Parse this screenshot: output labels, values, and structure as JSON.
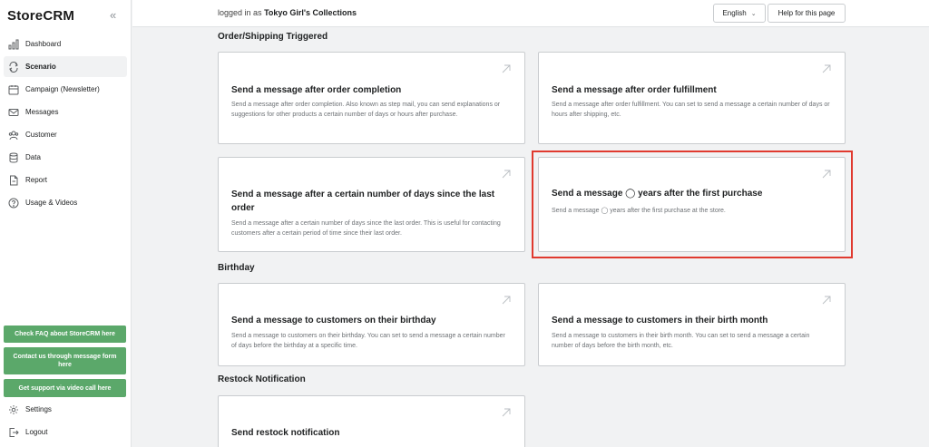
{
  "sidebar": {
    "brand": "StoreCRM",
    "collapse_glyph": "«",
    "items": [
      {
        "label": "Dashboard",
        "icon": "bar-chart-icon",
        "active": false
      },
      {
        "label": "Scenario",
        "icon": "refresh-icon",
        "active": true
      },
      {
        "label": "Campaign (Newsletter)",
        "icon": "calendar-icon",
        "active": false
      },
      {
        "label": "Messages",
        "icon": "envelope-icon",
        "active": false
      },
      {
        "label": "Customer",
        "icon": "users-icon",
        "active": false
      },
      {
        "label": "Data",
        "icon": "database-icon",
        "active": false
      },
      {
        "label": "Report",
        "icon": "document-icon",
        "active": false
      },
      {
        "label": "Usage & Videos",
        "icon": "help-circle-icon",
        "active": false
      }
    ],
    "buttons": {
      "faq": "Check FAQ about StoreCRM here",
      "contact": "Contact us through message form here",
      "video": "Get support via video call here"
    },
    "bottom_items": [
      {
        "label": "Settings",
        "icon": "gear-icon"
      },
      {
        "label": "Logout",
        "icon": "logout-icon"
      }
    ],
    "accent_color": "#5ba86a"
  },
  "topbar": {
    "logged_prefix": "logged in as",
    "store_name": "Tokyo Girl's Collections",
    "language": "English",
    "help_label": "Help for this page"
  },
  "sections": {
    "order": {
      "title": "Order/Shipping Triggered",
      "cards": [
        {
          "title": "Send a message after order completion",
          "desc": "Send a message after order completion. Also known as step mail, you can send explanations or suggestions for other products a certain number of days or hours after purchase."
        },
        {
          "title": "Send a message after order fulfillment",
          "desc": "Send a message after order fulfillment. You can set to send a message a certain number of days or hours after shipping, etc."
        },
        {
          "title": "Send a message after a certain number of days since the last order",
          "desc": "Send a message after a certain number of days since the last order. This is useful for contacting customers after a certain period of time since their last order."
        },
        {
          "title": "Send a message ◯ years after the first purchase",
          "desc": "Send a message ◯ years after the first purchase at the store."
        }
      ]
    },
    "birthday": {
      "title": "Birthday",
      "cards": [
        {
          "title": "Send a message to customers on their birthday",
          "desc": "Send a message to customers on their birthday. You can set to send a message a certain number of days before the birthday at a specific time."
        },
        {
          "title": "Send a message to customers in their birth month",
          "desc": "Send a message to customers in their birth month. You can set to send a message a certain number of days before the birth month, etc."
        }
      ]
    },
    "restock": {
      "title": "Restock Notification",
      "cards": [
        {
          "title": "Send restock notification",
          "desc": ""
        }
      ]
    }
  },
  "highlight_color": "#e03a2f"
}
